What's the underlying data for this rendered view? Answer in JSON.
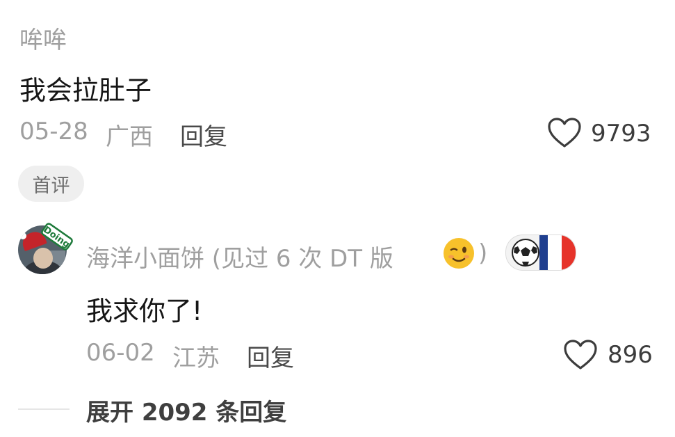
{
  "comment1": {
    "username": "哞哞",
    "text": "我会拉肚子",
    "date": "05-28",
    "location": "广西",
    "reply_label": "回复",
    "likes": "9793",
    "badge": "首评"
  },
  "comment2": {
    "username": "海洋小面饼 (见过 6 次 DT 版",
    "username_tail": ")",
    "avatar_tag": "Doing",
    "text": "我求你了!",
    "date": "06-02",
    "location": "江苏",
    "reply_label": "回复",
    "likes": "896"
  },
  "expand_label": "展开 2092 条回复",
  "colors": {
    "secondary_text": "#9f9f9f",
    "primary_text": "#161616",
    "badge_bg": "#efefef",
    "france_blue": "#1f3f8f",
    "france_red": "#e6332a"
  },
  "icons": [
    "heart-outline-icon",
    "winking-face-emoji",
    "soccer-ball-icon",
    "france-flag-icon"
  ]
}
